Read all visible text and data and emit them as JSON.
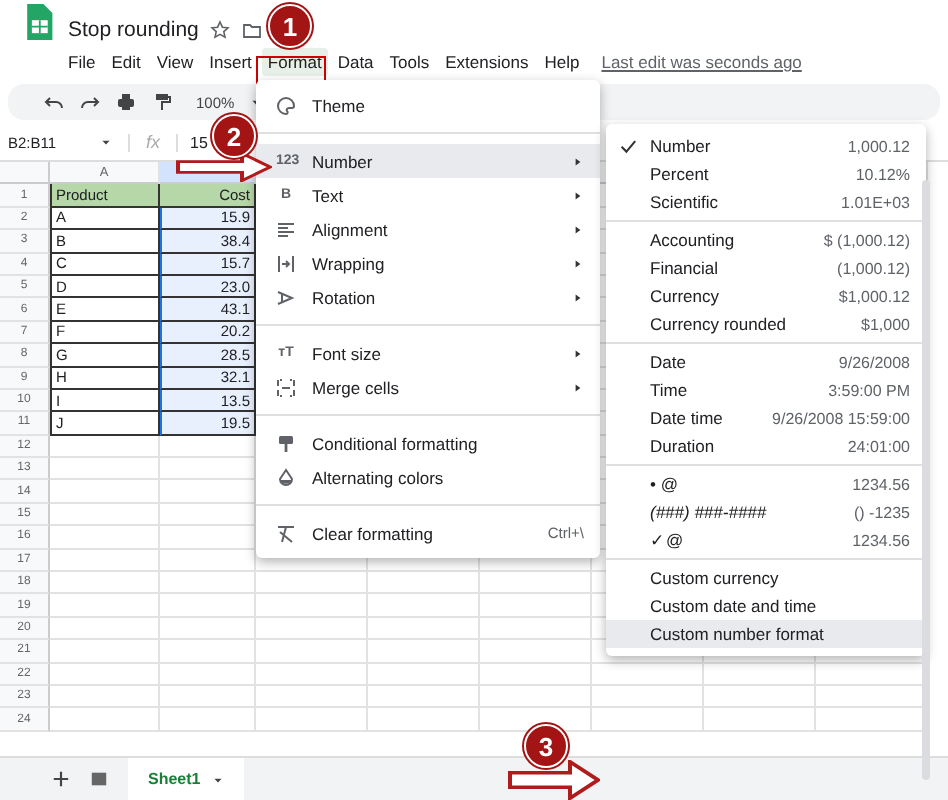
{
  "document": {
    "title": "Stop rounding",
    "last_edit": "Last edit was seconds ago"
  },
  "menus": [
    {
      "label": "File",
      "selected": false
    },
    {
      "label": "Edit",
      "selected": false
    },
    {
      "label": "View",
      "selected": false
    },
    {
      "label": "Insert",
      "selected": false
    },
    {
      "label": "Format",
      "selected": true
    },
    {
      "label": "Data",
      "selected": false
    },
    {
      "label": "Tools",
      "selected": false
    },
    {
      "label": "Extensions",
      "selected": false
    },
    {
      "label": "Help",
      "selected": false
    }
  ],
  "toolbar": {
    "zoom": "100%"
  },
  "formula_bar": {
    "name_box": "B2:B11",
    "fx": "fx",
    "value": "15"
  },
  "grid": {
    "columns": [
      "A"
    ],
    "rows": [
      {
        "number": "1",
        "cells": [
          "Product",
          "Cost"
        ],
        "header": true
      },
      {
        "number": "2",
        "cells": [
          "A",
          "15.9"
        ],
        "header": false
      },
      {
        "number": "3",
        "cells": [
          "B",
          "38.4"
        ],
        "header": false
      },
      {
        "number": "4",
        "cells": [
          "C",
          "15.7"
        ],
        "header": false
      },
      {
        "number": "5",
        "cells": [
          "D",
          "23.0"
        ],
        "header": false
      },
      {
        "number": "6",
        "cells": [
          "E",
          "43.1"
        ],
        "header": false
      },
      {
        "number": "7",
        "cells": [
          "F",
          "20.2"
        ],
        "header": false
      },
      {
        "number": "8",
        "cells": [
          "G",
          "28.5"
        ],
        "header": false
      },
      {
        "number": "9",
        "cells": [
          "H",
          "32.1"
        ],
        "header": false
      },
      {
        "number": "10",
        "cells": [
          "I",
          "13.5"
        ],
        "header": false
      },
      {
        "number": "11",
        "cells": [
          "J",
          "19.5"
        ],
        "header": false
      }
    ],
    "empty_rows": [
      "12",
      "13",
      "14",
      "15",
      "16",
      "17",
      "18",
      "19",
      "20",
      "21",
      "22",
      "23",
      "24"
    ]
  },
  "format_menu": {
    "groups": [
      {
        "items": [
          {
            "label": "Theme",
            "submenu": false,
            "selected": false
          }
        ]
      },
      {
        "items": [
          {
            "label": "Number",
            "glyph": "123",
            "submenu": true,
            "selected": true
          },
          {
            "label": "Text",
            "glyph": "B",
            "submenu": true,
            "selected": false
          },
          {
            "label": "Alignment",
            "submenu": true,
            "selected": false
          },
          {
            "label": "Wrapping",
            "submenu": true,
            "selected": false
          },
          {
            "label": "Rotation",
            "submenu": true,
            "selected": false
          }
        ]
      },
      {
        "items": [
          {
            "label": "Font size",
            "glyph": "тT",
            "submenu": true,
            "selected": false
          },
          {
            "label": "Merge cells",
            "submenu": true,
            "selected": false
          }
        ]
      },
      {
        "items": [
          {
            "label": "Conditional formatting",
            "submenu": false,
            "selected": false
          },
          {
            "label": "Alternating colors",
            "submenu": false,
            "selected": false
          }
        ]
      },
      {
        "items": [
          {
            "label": "Clear formatting",
            "submenu": false,
            "selected": false,
            "shortcut": "Ctrl+\\"
          }
        ]
      }
    ]
  },
  "number_menu": {
    "groups": [
      {
        "items": [
          {
            "label": "Number",
            "sample": "1,000.12",
            "checked": true,
            "selected": false
          },
          {
            "label": "Percent",
            "sample": "10.12%",
            "checked": false,
            "selected": false
          },
          {
            "label": "Scientific",
            "sample": "1.01E+03",
            "checked": false,
            "selected": false
          }
        ]
      },
      {
        "items": [
          {
            "label": "Accounting",
            "sample": "$ (1,000.12)",
            "checked": false,
            "selected": false
          },
          {
            "label": "Financial",
            "sample": "(1,000.12)",
            "checked": false,
            "selected": false
          },
          {
            "label": "Currency",
            "sample": "$1,000.12",
            "checked": false,
            "selected": false
          },
          {
            "label": "Currency rounded",
            "sample": "$1,000",
            "checked": false,
            "selected": false
          }
        ]
      },
      {
        "items": [
          {
            "label": "Date",
            "sample": "9/26/2008",
            "checked": false,
            "selected": false
          },
          {
            "label": "Time",
            "sample": "3:59:00 PM",
            "checked": false,
            "selected": false
          },
          {
            "label": "Date time",
            "sample": "9/26/2008 15:59:00",
            "checked": false,
            "selected": false
          },
          {
            "label": "Duration",
            "sample": "24:01:00",
            "checked": false,
            "selected": false
          }
        ]
      },
      {
        "items": [
          {
            "label": "• @",
            "sample": "1234.56",
            "checked": false,
            "selected": false
          },
          {
            "label": "(###) ###-####",
            "sample": "() -1235",
            "checked": false,
            "selected": false,
            "italic": true
          },
          {
            "label": "✓@",
            "sample": "1234.56",
            "checked": false,
            "selected": false
          }
        ]
      },
      {
        "items": [
          {
            "label": "Custom currency",
            "checked": false,
            "selected": false
          },
          {
            "label": "Custom date and time",
            "checked": false,
            "selected": false
          },
          {
            "label": "Custom number format",
            "checked": false,
            "selected": true
          }
        ]
      }
    ]
  },
  "sheet_tabs": [
    {
      "label": "Sheet1",
      "selected": true
    }
  ],
  "annotations": [
    {
      "number": "1"
    },
    {
      "number": "2"
    },
    {
      "number": "3"
    }
  ]
}
